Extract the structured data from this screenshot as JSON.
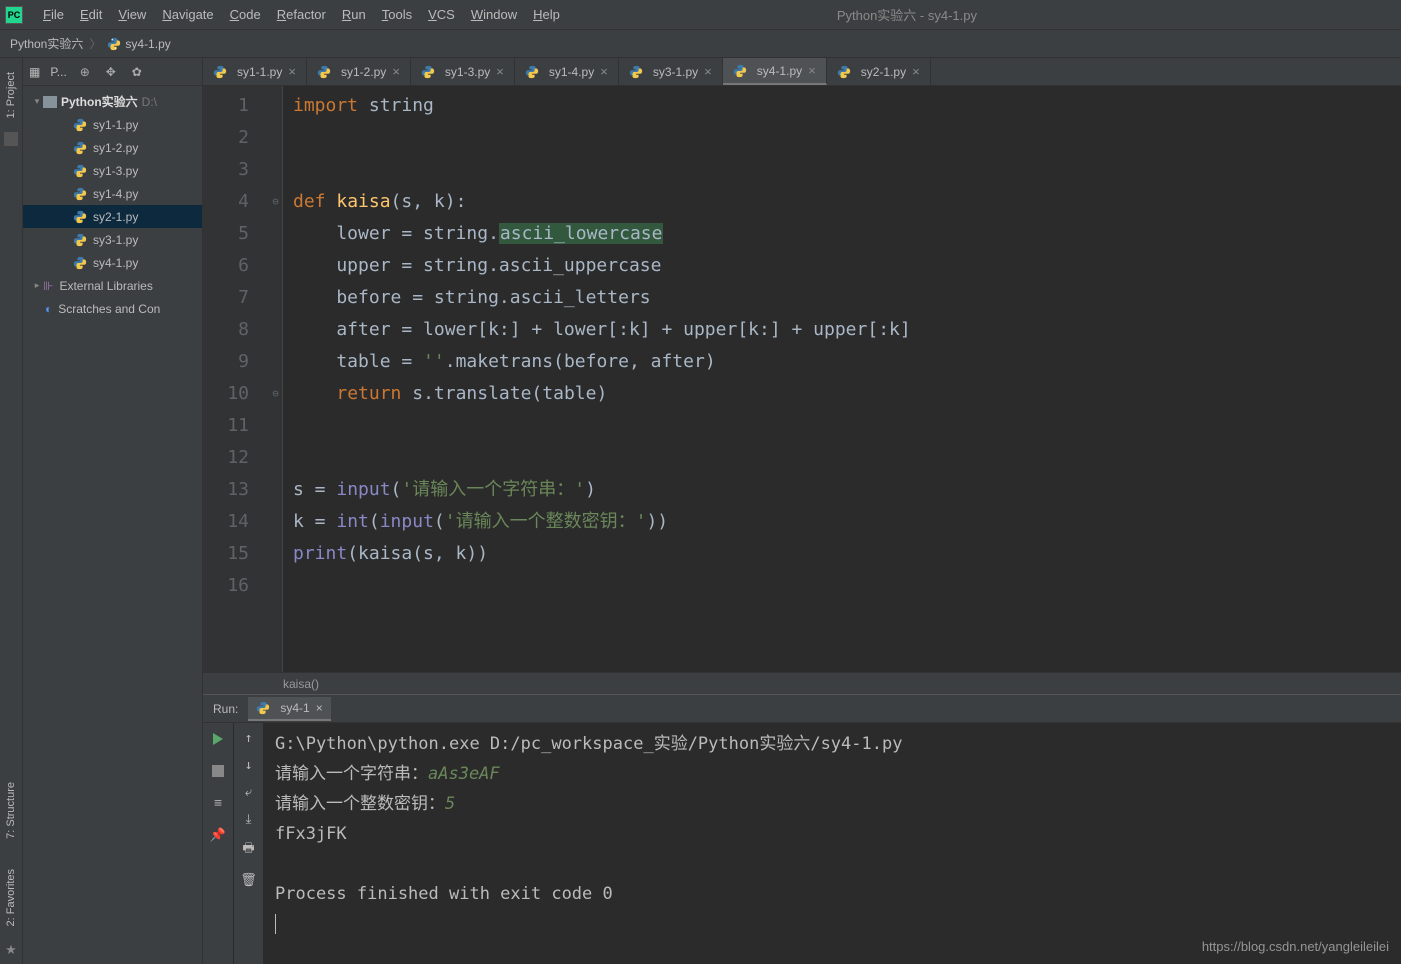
{
  "title": "Python实验六 - sy4-1.py",
  "menu": [
    "File",
    "Edit",
    "View",
    "Navigate",
    "Code",
    "Refactor",
    "Run",
    "Tools",
    "VCS",
    "Window",
    "Help"
  ],
  "breadcrumbs": {
    "project": "Python实验六",
    "file": "sy4-1.py"
  },
  "project_panel": {
    "label": "P...",
    "root": "Python实验六",
    "root_path": "D:\\",
    "files": [
      "sy1-1.py",
      "sy1-2.py",
      "sy1-3.py",
      "sy1-4.py",
      "sy2-1.py",
      "sy3-1.py",
      "sy4-1.py"
    ],
    "selected": "sy2-1.py",
    "external": "External Libraries",
    "scratches": "Scratches and Con"
  },
  "tabs": [
    "sy1-1.py",
    "sy1-2.py",
    "sy1-3.py",
    "sy1-4.py",
    "sy3-1.py",
    "sy4-1.py",
    "sy2-1.py"
  ],
  "active_tab": "sy4-1.py",
  "code_lines": [
    {
      "n": 1,
      "html": "<span class='kw'>import</span> string"
    },
    {
      "n": 2,
      "html": ""
    },
    {
      "n": 3,
      "html": ""
    },
    {
      "n": 4,
      "html": "<span class='kw'>def</span>&nbsp;<span class='fn'>kaisa</span>(s, k):",
      "fold": "⊖"
    },
    {
      "n": 5,
      "html": "    lower = string.<span class='hl-bg'>ascii_lowercase</span>"
    },
    {
      "n": 6,
      "html": "    upper = string.ascii_uppercase"
    },
    {
      "n": 7,
      "html": "    before = string.ascii_letters"
    },
    {
      "n": 8,
      "html": "    after = lower[k:] + lower[:k] + upper[k:] + upper[:k]"
    },
    {
      "n": 9,
      "html": "    table = <span class='str'>''</span>.maketrans(before, after)"
    },
    {
      "n": 10,
      "html": "    <span class='kw'>return</span> s.translate(table)",
      "fold": "⊖"
    },
    {
      "n": 11,
      "html": ""
    },
    {
      "n": 12,
      "html": ""
    },
    {
      "n": 13,
      "html": "s = <span class='builtin'>input</span>(<span class='str'>'请输入一个字符串：'</span>)"
    },
    {
      "n": 14,
      "html": "k = <span class='builtin'>int</span>(<span class='builtin'>input</span>(<span class='str'>'请输入一个整数密钥：'</span>))"
    },
    {
      "n": 15,
      "html": "<span class='builtin'>print</span>(kaisa(s, k))"
    },
    {
      "n": 16,
      "html": ""
    }
  ],
  "context": "kaisa()",
  "run": {
    "label": "Run:",
    "tab": "sy4-1",
    "lines": [
      {
        "html": "G:\\Python\\python.exe D:/pc_workspace_实验/Python实验六/sy4-1.py"
      },
      {
        "html": "请输入一个字符串：<span class='inp'>aAs3eAF</span>"
      },
      {
        "html": "请输入一个整数密钥：<span class='inp'>5</span>"
      },
      {
        "html": "fFx3jFK"
      },
      {
        "html": ""
      },
      {
        "html": "Process finished with exit code 0"
      },
      {
        "html": "<span class='caret'>&nbsp;</span>"
      }
    ]
  },
  "side_tabs": {
    "project": "1: Project",
    "structure": "7: Structure",
    "favorites": "2: Favorites"
  },
  "watermark": "https://blog.csdn.net/yangleileilei"
}
